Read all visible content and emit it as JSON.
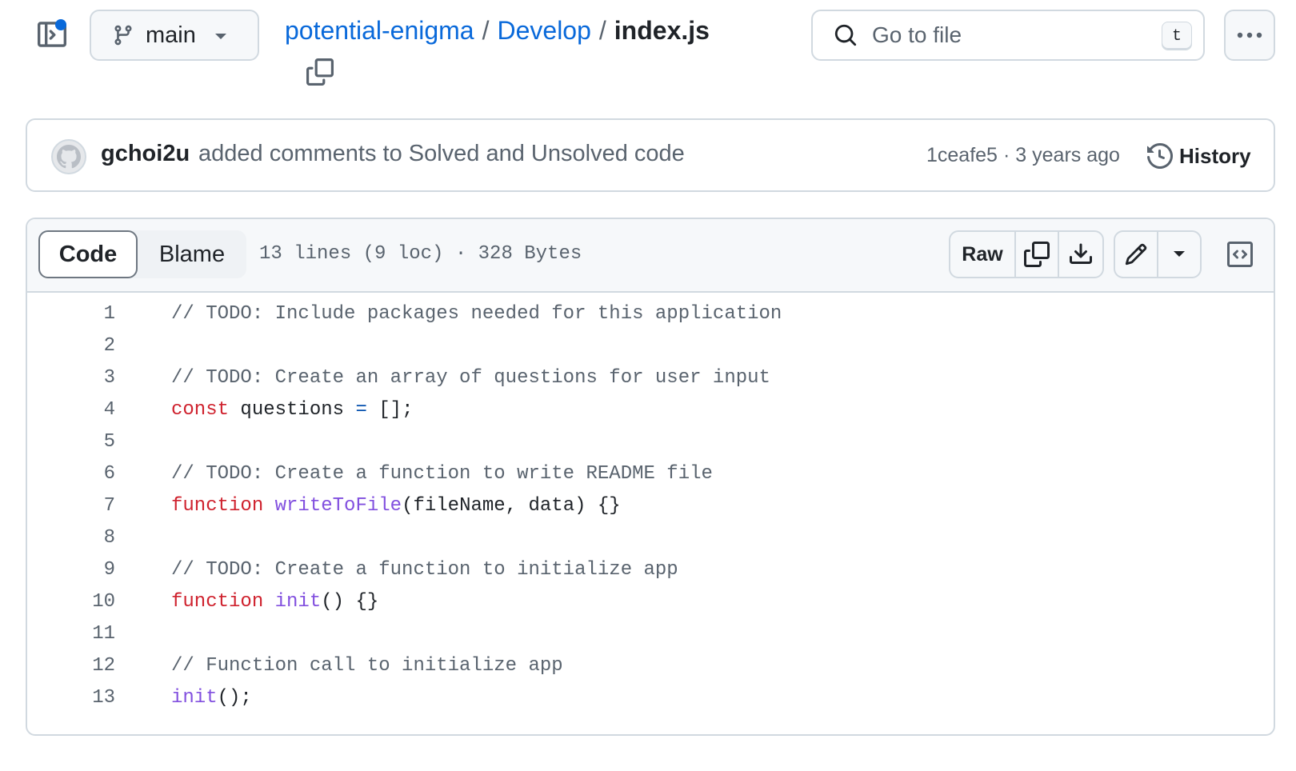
{
  "header": {
    "branch": "main",
    "breadcrumb": {
      "repo": "potential-enigma",
      "separator": "/",
      "folder": "Develop",
      "file": "index.js"
    },
    "search": {
      "placeholder": "Go to file",
      "shortcut": "t"
    }
  },
  "commit": {
    "author": "gchoi2u",
    "message": "added comments to Solved and Unsolved code",
    "sha": "1ceafe5",
    "separator": "·",
    "time": "3 years ago",
    "history_label": "History"
  },
  "file": {
    "tabs": {
      "code": "Code",
      "blame": "Blame"
    },
    "info": "13 lines (9 loc) · 328 Bytes",
    "raw_label": "Raw",
    "lines": [
      {
        "num": "1",
        "tokens": [
          {
            "t": "comment",
            "v": "// TODO: Include packages needed for this application"
          }
        ]
      },
      {
        "num": "2",
        "tokens": []
      },
      {
        "num": "3",
        "tokens": [
          {
            "t": "comment",
            "v": "// TODO: Create an array of questions for user input"
          }
        ]
      },
      {
        "num": "4",
        "tokens": [
          {
            "t": "keyword",
            "v": "const"
          },
          {
            "t": "plain",
            "v": " questions "
          },
          {
            "t": "op",
            "v": "="
          },
          {
            "t": "plain",
            "v": " [];"
          }
        ]
      },
      {
        "num": "5",
        "tokens": []
      },
      {
        "num": "6",
        "tokens": [
          {
            "t": "comment",
            "v": "// TODO: Create a function to write README file"
          }
        ]
      },
      {
        "num": "7",
        "tokens": [
          {
            "t": "keyword",
            "v": "function"
          },
          {
            "t": "plain",
            "v": " "
          },
          {
            "t": "func",
            "v": "writeToFile"
          },
          {
            "t": "plain",
            "v": "(fileName, data) {}"
          }
        ]
      },
      {
        "num": "8",
        "tokens": []
      },
      {
        "num": "9",
        "tokens": [
          {
            "t": "comment",
            "v": "// TODO: Create a function to initialize app"
          }
        ]
      },
      {
        "num": "10",
        "tokens": [
          {
            "t": "keyword",
            "v": "function"
          },
          {
            "t": "plain",
            "v": " "
          },
          {
            "t": "func",
            "v": "init"
          },
          {
            "t": "plain",
            "v": "() {}"
          }
        ]
      },
      {
        "num": "11",
        "tokens": []
      },
      {
        "num": "12",
        "tokens": [
          {
            "t": "comment",
            "v": "// Function call to initialize app"
          }
        ]
      },
      {
        "num": "13",
        "tokens": [
          {
            "t": "func",
            "v": "init"
          },
          {
            "t": "plain",
            "v": "();"
          }
        ]
      }
    ]
  },
  "colors": {
    "link": "#0969da",
    "comment": "#59636e",
    "keyword": "#cf222e",
    "function": "#8250df",
    "operator": "#0550ae",
    "border": "#d1d9e0",
    "notification_dot": "#0969da"
  },
  "icons": [
    "sidebar-toggle-icon",
    "git-branch-icon",
    "chevron-down-icon",
    "copy-icon",
    "search-icon",
    "kebab-horizontal-icon",
    "github-avatar-icon",
    "history-icon",
    "download-icon",
    "pencil-icon",
    "code-square-icon"
  ]
}
